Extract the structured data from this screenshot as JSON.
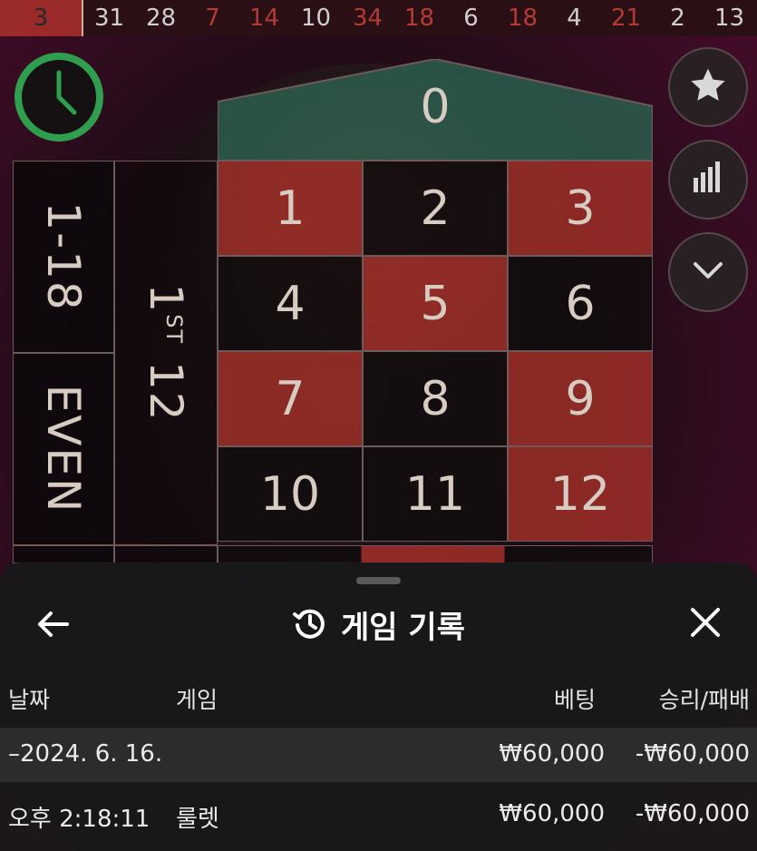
{
  "history": [
    {
      "value": "3",
      "color": "red",
      "current": true
    },
    {
      "value": "31",
      "color": "black"
    },
    {
      "value": "28",
      "color": "black"
    },
    {
      "value": "7",
      "color": "red"
    },
    {
      "value": "14",
      "color": "red"
    },
    {
      "value": "10",
      "color": "black"
    },
    {
      "value": "34",
      "color": "red"
    },
    {
      "value": "18",
      "color": "red"
    },
    {
      "value": "6",
      "color": "black"
    },
    {
      "value": "18",
      "color": "red"
    },
    {
      "value": "4",
      "color": "black"
    },
    {
      "value": "21",
      "color": "red"
    },
    {
      "value": "2",
      "color": "black"
    },
    {
      "value": "13",
      "color": "black"
    }
  ],
  "table": {
    "zero": "0",
    "numbers": [
      {
        "n": "1",
        "color": "red"
      },
      {
        "n": "2",
        "color": "black"
      },
      {
        "n": "3",
        "color": "red"
      },
      {
        "n": "4",
        "color": "black"
      },
      {
        "n": "5",
        "color": "red"
      },
      {
        "n": "6",
        "color": "black"
      },
      {
        "n": "7",
        "color": "red"
      },
      {
        "n": "8",
        "color": "black"
      },
      {
        "n": "9",
        "color": "red"
      },
      {
        "n": "10",
        "color": "black"
      },
      {
        "n": "11",
        "color": "black"
      },
      {
        "n": "12",
        "color": "red"
      }
    ],
    "low_label": "1-18",
    "even_label": "EVEN",
    "dozen_number": "1",
    "dozen_suffix": "ST",
    "dozen_count": "12"
  },
  "side_buttons": [
    {
      "icon": "star-icon"
    },
    {
      "icon": "statistics-icon"
    },
    {
      "icon": "chevron-down-icon"
    }
  ],
  "sheet": {
    "title": "게임 기록",
    "columns": {
      "date": "날짜",
      "game": "게임",
      "bet": "베팅",
      "result": "승리/패배"
    },
    "date_row": {
      "date": "–2024. 6. 16.",
      "bet": "₩60,000",
      "result": "-₩60,000"
    },
    "game_row": {
      "time": "오후 2:18:11",
      "game": "룰렛",
      "bet": "₩60,000",
      "result": "-₩60,000"
    }
  },
  "colors": {
    "red": "#b33a35",
    "green": "#2f9e4f",
    "felt_green": "#2b5e4e"
  }
}
